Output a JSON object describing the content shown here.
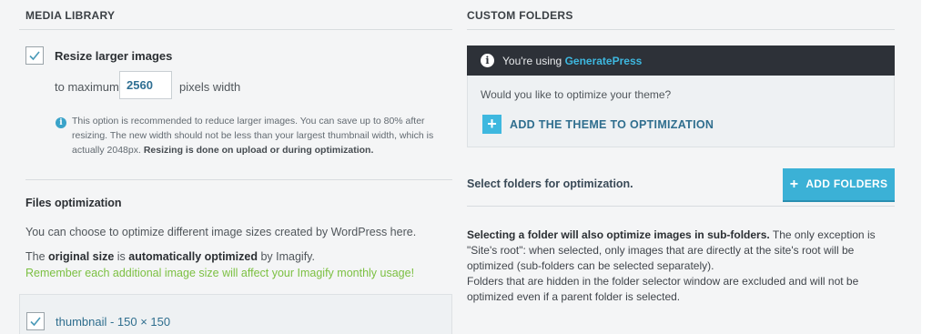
{
  "media_library": {
    "title": "MEDIA LIBRARY",
    "resize_label": "Resize larger images",
    "to_maximum": "to maximum",
    "width_value": "2560",
    "pixels_width": "pixels width",
    "info_line1": "This option is recommended to reduce larger images. You can save up to 80% after",
    "info_line2": "resizing. The new width should not be less than your largest thumbnail width, which is",
    "info_line3_plain": "actually 2048px.",
    "info_line3_bold": "Resizing is done on upload or during optimization."
  },
  "files_optimization": {
    "title": "Files optimization",
    "desc": "You can choose to optimize different image sizes created by WordPress here.",
    "line_the": "The",
    "line_original": "original size",
    "line_is": "is",
    "line_auto": "automatically optimized",
    "line_by": "by Imagify.",
    "warning": "Remember each additional image size will affect your Imagify monthly usage!",
    "thumbnail_label": "thumbnail - 150 × 150"
  },
  "custom_folders": {
    "title": "CUSTOM FOLDERS",
    "using_prefix": "You're using",
    "theme_name": "GeneratePress",
    "question": "Would you like to optimize your theme?",
    "add_theme_label": "ADD THE THEME TO OPTIMIZATION",
    "select_label": "Select folders for optimization.",
    "add_folders_label": "ADD FOLDERS",
    "note_bold": "Selecting a folder will also optimize images in sub-folders.",
    "note_rest1": "The only exception is",
    "note_line2": "\"Site's root\": when selected, only images that are directly at the site's root will be",
    "note_line3": "optimized (sub-folders can be selected separately).",
    "note_line4": "Folders that are hidden in the folder selector window are excluded and will not be",
    "note_line5": "optimized even if a parent folder is selected."
  },
  "colors": {
    "accent": "#3eb8df",
    "link": "#2f6e8e",
    "warning_green": "#7cc042",
    "dark_bar": "#2d3138"
  }
}
